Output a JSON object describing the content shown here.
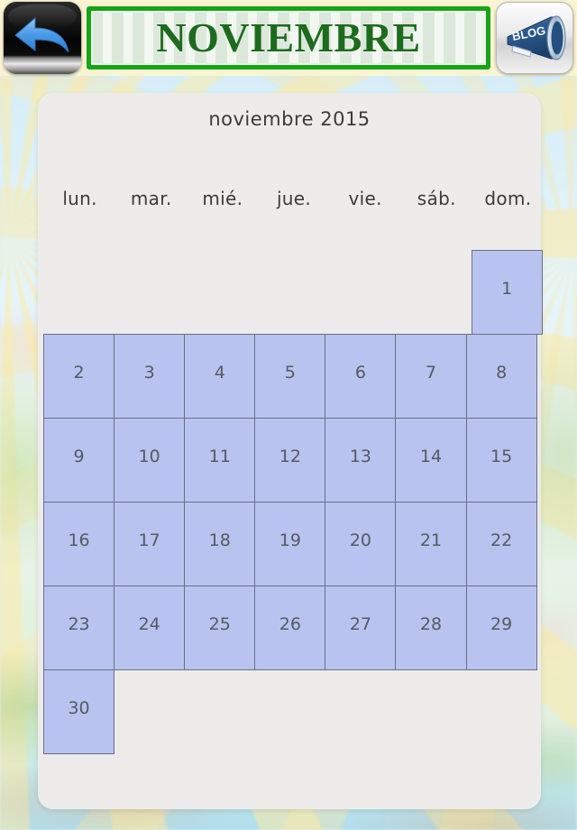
{
  "topbar": {
    "back_button": {
      "name": "back-button",
      "icon": "back-arrow-icon",
      "label": ""
    },
    "banner": {
      "text": "NOVIEMBRE",
      "border_color": "#18a318",
      "text_color": "#1d6b1d"
    },
    "blog_button": {
      "name": "blog-button",
      "icon": "megaphone-icon",
      "label": "BLOG"
    }
  },
  "calendar": {
    "title": "noviembre 2015",
    "weekdays": [
      "lun.",
      "mar.",
      "mié.",
      "jue.",
      "vie.",
      "sáb.",
      "dom."
    ],
    "cell_fill_color": "#b8c3ef",
    "cell_border_color": "#6b6f86",
    "panel_color": "#edecea",
    "weeks": [
      [
        "",
        "",
        "",
        "",
        "",
        "",
        "1"
      ],
      [
        "2",
        "3",
        "4",
        "5",
        "6",
        "7",
        "8"
      ],
      [
        "9",
        "10",
        "11",
        "12",
        "13",
        "14",
        "15"
      ],
      [
        "16",
        "17",
        "18",
        "19",
        "20",
        "21",
        "22"
      ],
      [
        "23",
        "24",
        "25",
        "26",
        "27",
        "28",
        "29"
      ],
      [
        "30",
        "",
        "",
        "",
        "",
        "",
        ""
      ]
    ]
  }
}
